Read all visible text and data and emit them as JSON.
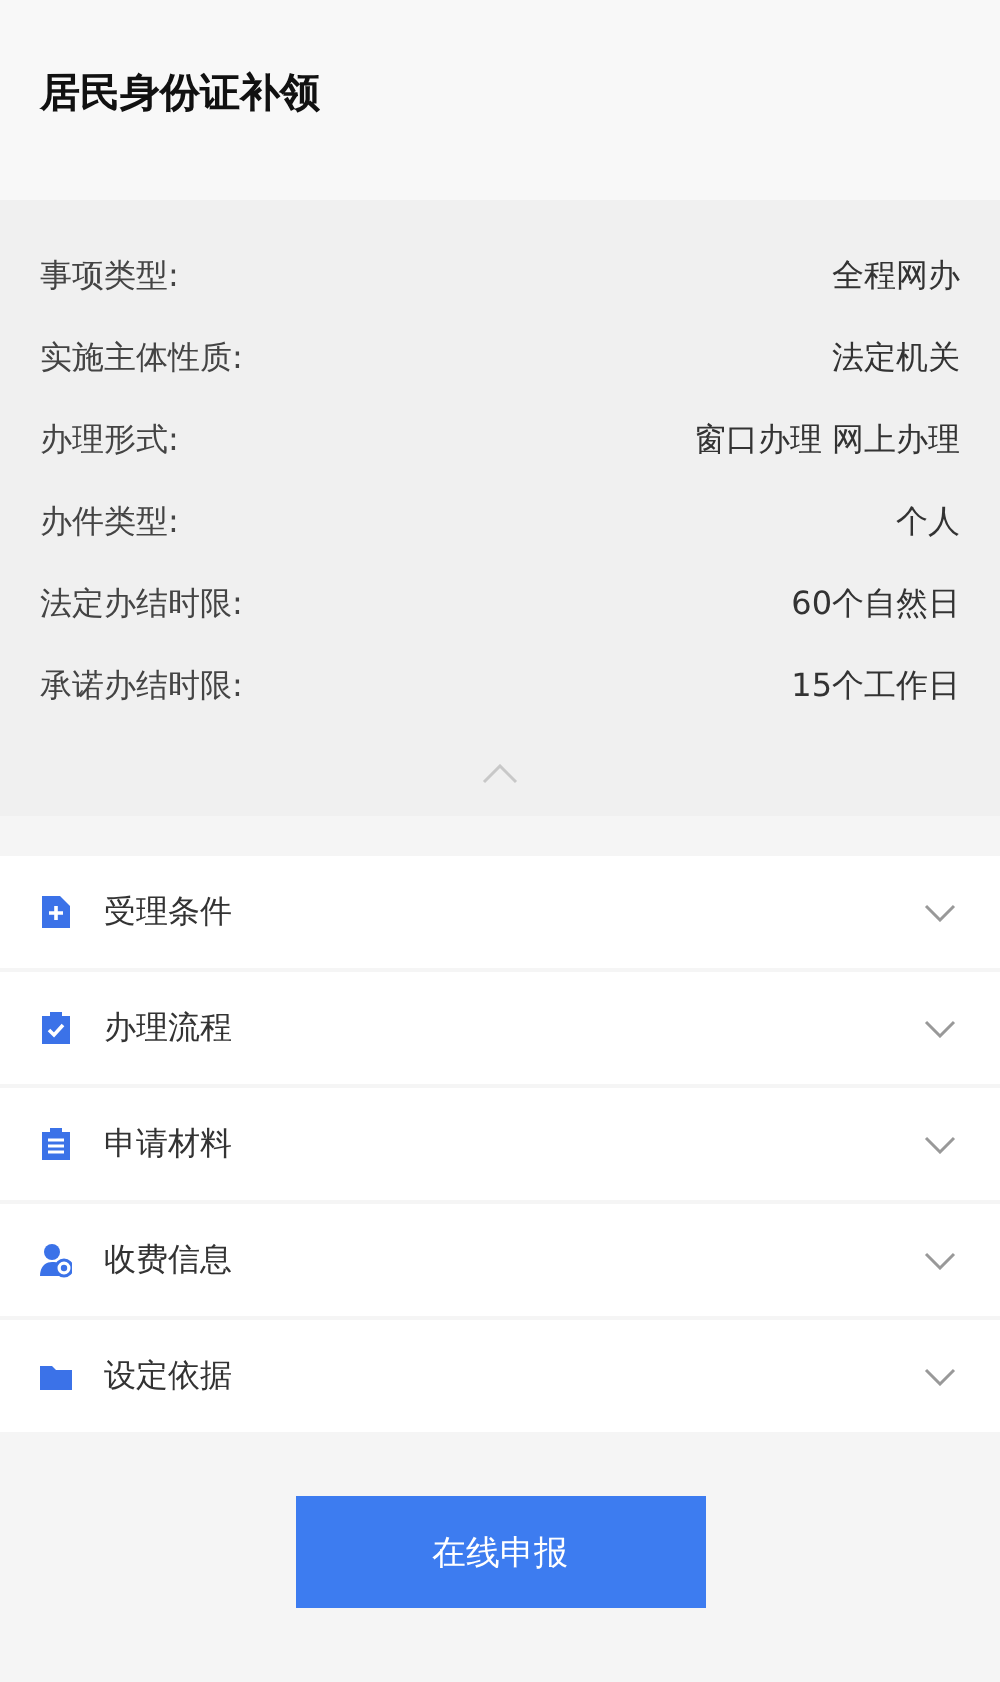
{
  "title": "居民身份证补领",
  "details": {
    "expanded": true,
    "rows": [
      {
        "label": "事项类型:",
        "value": "全程网办"
      },
      {
        "label": "实施主体性质:",
        "value": "法定机关"
      },
      {
        "label": "办理形式:",
        "value": "窗口办理 网上办理"
      },
      {
        "label": "办件类型:",
        "value": "个人"
      },
      {
        "label": "法定办结时限:",
        "value": "60个自然日"
      },
      {
        "label": "承诺办结时限:",
        "value": "15个工作日"
      }
    ]
  },
  "sections": [
    {
      "kind": "conditions",
      "label": "受理条件",
      "expanded": false
    },
    {
      "kind": "process",
      "label": "办理流程",
      "expanded": false
    },
    {
      "kind": "materials",
      "label": "申请材料",
      "expanded": false
    },
    {
      "kind": "fees",
      "label": "收费信息",
      "expanded": false
    },
    {
      "kind": "basis",
      "label": "设定依据",
      "expanded": false
    }
  ],
  "submit_button": "在线申报"
}
